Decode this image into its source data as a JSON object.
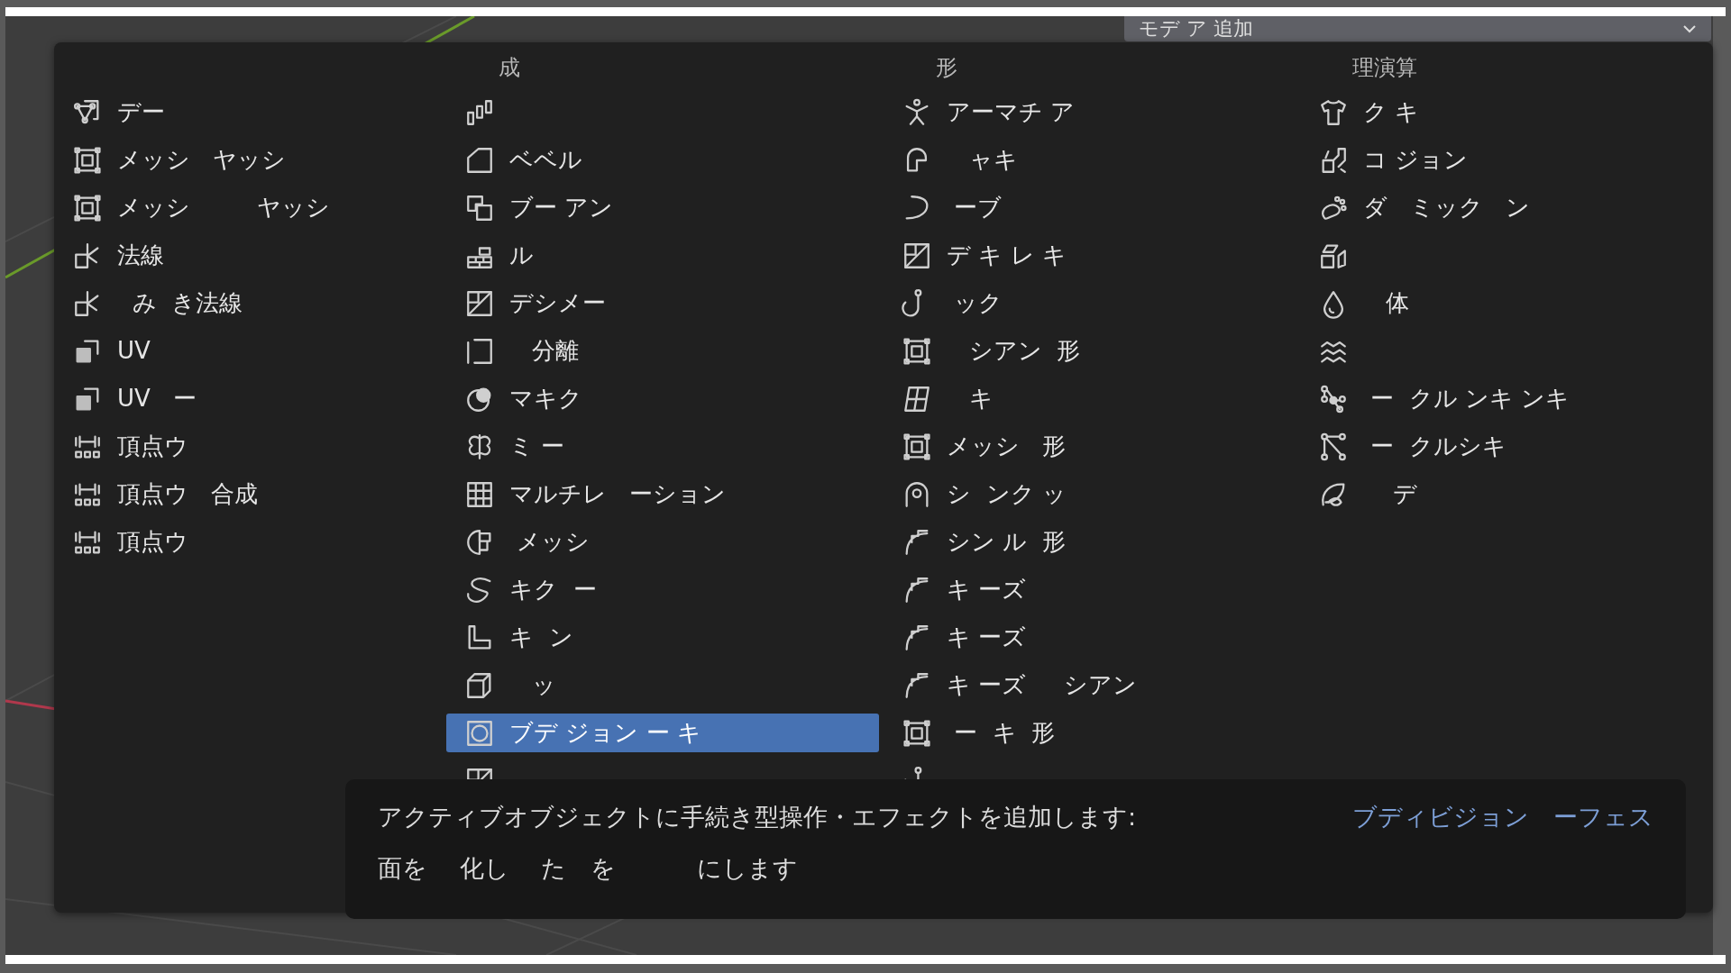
{
  "header_dropdown": {
    "label": "モデ ア 追加"
  },
  "menu": {
    "columns": [
      {
        "items": [
          {
            "label": "デー",
            "selected": false
          },
          {
            "label": "メッシ   ヤッシ",
            "selected": false
          },
          {
            "label": "メッシ         ヤッシ",
            "selected": false
          },
          {
            "label": "法線",
            "selected": false
          },
          {
            "label": "  み  き法線",
            "selected": false
          },
          {
            "label": "UV",
            "selected": false
          },
          {
            "label": "UV   ー",
            "selected": false
          },
          {
            "label": "頂点ウ",
            "selected": false
          },
          {
            "label": "頂点ウ   合成",
            "selected": false
          },
          {
            "label": "頂点ウ",
            "selected": false
          }
        ]
      },
      {
        "heading": "成",
        "items": [
          {
            "selected": false
          },
          {
            "label": "ベベル",
            "selected": false
          },
          {
            "label": "ブー アン",
            "selected": false
          },
          {
            "label": "ル",
            "selected": false
          },
          {
            "label": "デシメー",
            "selected": false
          },
          {
            "label": "   分離",
            "selected": false
          },
          {
            "label": "マキク",
            "selected": false
          },
          {
            "label": "ミ ー",
            "selected": false
          },
          {
            "label": "マルチレ   ーション",
            "selected": false
          },
          {
            "label": " メッシ",
            "selected": false
          },
          {
            "label": "キク  ー",
            "selected": false
          },
          {
            "label": "キ  ン",
            "selected": false
          },
          {
            "label": "   ッ",
            "selected": false
          },
          {
            "label": "ブデ ジョン ー キ",
            "selected": true
          },
          {
            "selected": false
          }
        ]
      },
      {
        "heading": "形",
        "items": [
          {
            "label": "アーマチ ア",
            "selected": false
          },
          {
            "label": "   ャキ",
            "selected": false
          },
          {
            "label": " ーブ",
            "selected": false
          },
          {
            "label": "デ キ レ キ",
            "selected": false
          },
          {
            "label": " ック",
            "selected": false
          },
          {
            "label": "   シアン  形",
            "selected": false
          },
          {
            "label": "   キ",
            "selected": false
          },
          {
            "label": "メッシ   形",
            "selected": false
          },
          {
            "label": "シ  ンク ッ",
            "selected": false
          },
          {
            "label": "シン ル  形",
            "selected": false
          },
          {
            "label": "キ ーズ",
            "selected": false
          },
          {
            "label": "キ ーズ",
            "selected": false
          },
          {
            "label": "キ ーズ     シアン",
            "selected": false
          },
          {
            "label": " ー  キ  形",
            "selected": false
          },
          {
            "selected": false
          }
        ]
      },
      {
        "heading": "理演算",
        "items": [
          {
            "label": "ク キ",
            "selected": false
          },
          {
            "label": "コ ジョン",
            "selected": false
          },
          {
            "label": "ダ   ミック   ン",
            "selected": false
          },
          {
            "selected": false
          },
          {
            "label": "   体",
            "selected": false
          },
          {
            "selected": false
          },
          {
            "label": " ー  クル ンキ ンキ",
            "selected": false
          },
          {
            "label": " ー  クルシキ",
            "selected": false
          },
          {
            "label": "    デ",
            "selected": false
          }
        ]
      }
    ]
  },
  "tooltip": {
    "description": "アクティブオブジェクトに手続き型操作・エフェクトを追加します:",
    "name": "ブディビジョン　ーフェス",
    "detail": "面を　 化し　 た　を　　　 にします"
  }
}
